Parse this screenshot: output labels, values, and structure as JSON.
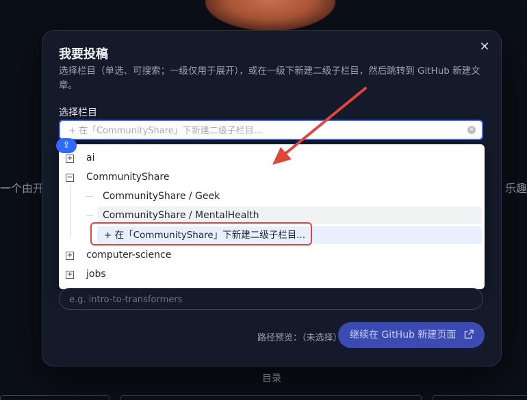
{
  "background": {
    "left_snippet": "一个由开",
    "right_snippet": "乐趣",
    "toc": "目录"
  },
  "modal": {
    "title": "我要投稿",
    "description": "选择栏目（单选、可搜索；一级仅用于展开），或在一级下新建二级子栏目，然后跳转到 GitHub 新建文章。",
    "field_label": "选择栏目",
    "search_placeholder": "+ 在「CommunityShare」下新建二级子栏目...",
    "close_icon": "close-icon",
    "tree": [
      {
        "label": "ai",
        "expanded": false
      },
      {
        "label": "CommunityShare",
        "expanded": true
      },
      {
        "label": "CommunityShare / Geek",
        "child": true
      },
      {
        "label": "CommunityShare / MentalHealth",
        "child": true
      },
      {
        "label": "+ 在「CommunityShare」下新建二级子栏目...",
        "create": true
      },
      {
        "label": "computer-science",
        "expanded": false
      },
      {
        "label": "jobs",
        "expanded": false
      }
    ],
    "slug_placeholder": "e.g. intro-to-transformers",
    "path_preview": "路径预览：（未选择）",
    "continue_label": "继续在 GitHub 新建页面"
  },
  "colors": {
    "accent": "#3b6cff",
    "button_bg": "#3b4bb3",
    "annotation_red": "#e2453a"
  }
}
